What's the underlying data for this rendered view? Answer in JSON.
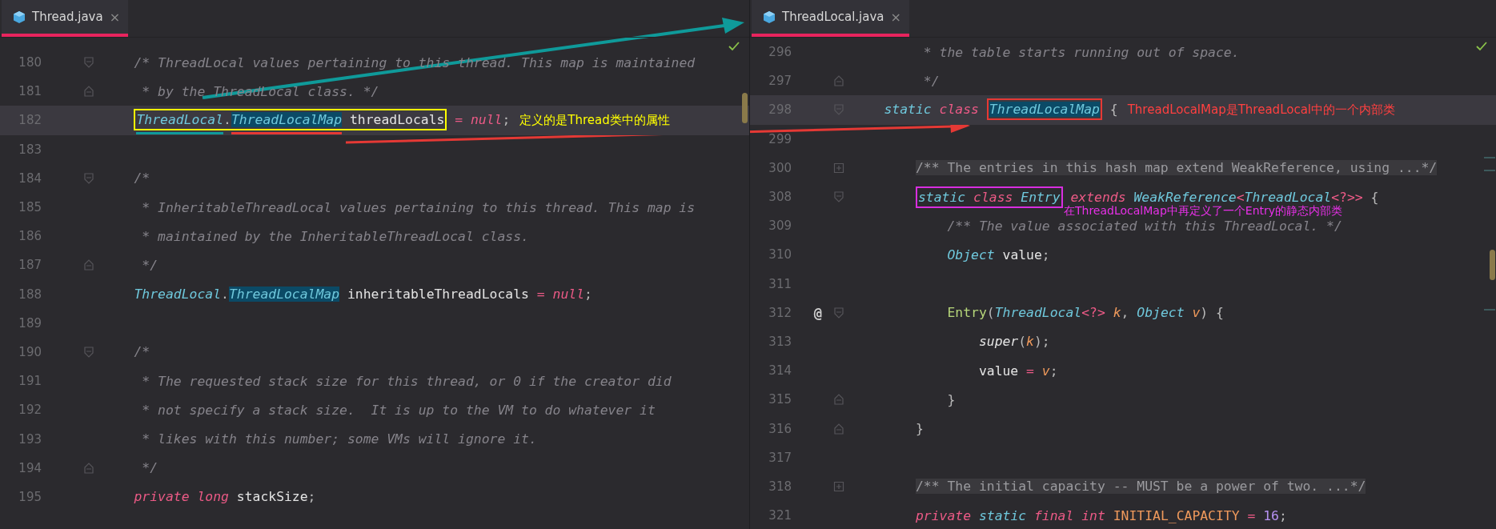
{
  "panes": [
    {
      "tab": {
        "label": "Thread.java",
        "close": "×",
        "selected": true
      },
      "lines": [
        {
          "number": "180",
          "fold_start": true,
          "tokens": [
            {
              "kind": "comment",
              "text": "    /* ThreadLocal values pertaining to this thread. This map is maintained"
            }
          ]
        },
        {
          "number": "181",
          "fold_end": true,
          "tokens": [
            {
              "kind": "comment",
              "text": "     * by the ThreadLocal class. */"
            }
          ]
        },
        {
          "number": "182",
          "current": true,
          "tokens": [
            {
              "kind": "box",
              "color": "#ffff00",
              "tokens": [
                {
                  "kind": "type",
                  "text": "    ThreadLocal",
                  "underline": {
                    "color": "#0f9a9a"
                  }
                },
                {
                  "kind": "punct",
                  "text": "."
                },
                {
                  "kind": "type",
                  "text": "ThreadLocalMap",
                  "highlighted": true,
                  "underline": {
                    "color": "#e53935"
                  }
                },
                {
                  "kind": "plain",
                  "text": " threadLocals"
                }
              ]
            },
            {
              "kind": "op",
              "text": " = "
            },
            {
              "kind": "keyword",
              "text": "null"
            },
            {
              "kind": "punct",
              "text": ";"
            },
            {
              "kind": "note",
              "color": "#ffff00",
              "text": "定义的是Thread类中的属性"
            }
          ]
        },
        {
          "number": "183"
        },
        {
          "number": "184",
          "fold_start": true,
          "tokens": [
            {
              "kind": "comment",
              "text": "    /*"
            }
          ]
        },
        {
          "number": "185",
          "tokens": [
            {
              "kind": "comment",
              "text": "     * InheritableThreadLocal values pertaining to this thread. This map is"
            }
          ]
        },
        {
          "number": "186",
          "tokens": [
            {
              "kind": "comment",
              "text": "     * maintained by the InheritableThreadLocal class."
            }
          ]
        },
        {
          "number": "187",
          "fold_end": true,
          "tokens": [
            {
              "kind": "comment",
              "text": "     */"
            }
          ]
        },
        {
          "number": "188",
          "tokens": [
            {
              "kind": "type",
              "text": "    ThreadLocal"
            },
            {
              "kind": "punct",
              "text": "."
            },
            {
              "kind": "type",
              "text": "ThreadLocalMap",
              "highlighted": true
            },
            {
              "kind": "plain",
              "text": " inheritableThreadLocals"
            },
            {
              "kind": "op",
              "text": " = "
            },
            {
              "kind": "keyword",
              "text": "null"
            },
            {
              "kind": "punct",
              "text": ";"
            }
          ]
        },
        {
          "number": "189"
        },
        {
          "number": "190",
          "fold_start": true,
          "tokens": [
            {
              "kind": "comment",
              "text": "    /*"
            }
          ]
        },
        {
          "number": "191",
          "tokens": [
            {
              "kind": "comment",
              "text": "     * The requested stack size for this thread, or 0 if the creator did"
            }
          ]
        },
        {
          "number": "192",
          "tokens": [
            {
              "kind": "comment",
              "text": "     * not specify a stack size.  It is up to the VM to do whatever it"
            }
          ]
        },
        {
          "number": "193",
          "tokens": [
            {
              "kind": "comment",
              "text": "     * likes with this number; some VMs will ignore it."
            }
          ]
        },
        {
          "number": "194",
          "fold_end": true,
          "tokens": [
            {
              "kind": "comment",
              "text": "     */"
            }
          ]
        },
        {
          "number": "195",
          "tokens": [
            {
              "kind": "keyword",
              "text": "    private"
            },
            {
              "kind": "keyword",
              "text": " long"
            },
            {
              "kind": "plain",
              "text": " stackSize"
            },
            {
              "kind": "punct",
              "text": ";"
            }
          ]
        }
      ]
    },
    {
      "tab": {
        "label": "ThreadLocal.java",
        "close": "×",
        "selected": true
      },
      "lines": [
        {
          "number": "296",
          "tokens": [
            {
              "kind": "comment",
              "text": "         * the table starts running out of space."
            }
          ]
        },
        {
          "number": "297",
          "fold_end": true,
          "tokens": [
            {
              "kind": "comment",
              "text": "         */"
            }
          ]
        },
        {
          "number": "298",
          "current": true,
          "fold_start": true,
          "tokens": [
            {
              "kind": "modifier",
              "text": "    static"
            },
            {
              "kind": "keyword",
              "text": " class"
            },
            {
              "kind": "box",
              "color": "#e53935",
              "tokens": [
                {
                  "kind": "type",
                  "text": " ThreadLocalMap",
                  "highlighted": true
                }
              ]
            },
            {
              "kind": "punct",
              "text": " {"
            },
            {
              "kind": "note",
              "color": "#ff4040",
              "text": "ThreadLocalMap是ThreadLocal中的一个内部类"
            }
          ]
        },
        {
          "number": "299"
        },
        {
          "number": "300",
          "collapsed": true,
          "tokens": [
            {
              "kind": "folded",
              "text": "        /** The entries in this hash map extend WeakReference, using ...*/"
            }
          ]
        },
        {
          "number": "308",
          "fold_start": true,
          "tokens": [
            {
              "kind": "box",
              "color": "#d82ee0",
              "tokens": [
                {
                  "kind": "modifier",
                  "text": "        static"
                },
                {
                  "kind": "keyword",
                  "text": " class"
                },
                {
                  "kind": "type",
                  "text": " Entry"
                }
              ]
            },
            {
              "kind": "keyword",
              "text": " extends"
            },
            {
              "kind": "type",
              "text": " WeakReference"
            },
            {
              "kind": "op",
              "text": "<"
            },
            {
              "kind": "type",
              "text": "ThreadLocal"
            },
            {
              "kind": "op",
              "text": "<?>>"
            },
            {
              "kind": "punct",
              "text": " {"
            },
            {
              "kind": "note",
              "below": true,
              "color": "#e830e8",
              "text": "在ThreadLocalMap中再定义了一个Entry的静态内部类"
            }
          ]
        },
        {
          "number": "309",
          "tokens": [
            {
              "kind": "comment",
              "text": "            /** The value associated with this ThreadLocal. */"
            }
          ]
        },
        {
          "number": "310",
          "tokens": [
            {
              "kind": "type",
              "text": "            Object"
            },
            {
              "kind": "plain",
              "text": " value"
            },
            {
              "kind": "punct",
              "text": ";"
            }
          ]
        },
        {
          "number": "311"
        },
        {
          "number": "312",
          "mark": "@",
          "fold_start": true,
          "tokens": [
            {
              "kind": "method",
              "text": "            Entry"
            },
            {
              "kind": "punct",
              "text": "("
            },
            {
              "kind": "type",
              "text": "ThreadLocal"
            },
            {
              "kind": "op",
              "text": "<?>"
            },
            {
              "kind": "param",
              "text": " k"
            },
            {
              "kind": "punct",
              "text": ", "
            },
            {
              "kind": "type",
              "text": "Object"
            },
            {
              "kind": "param",
              "text": " v"
            },
            {
              "kind": "punct",
              "text": ") {"
            }
          ]
        },
        {
          "number": "313",
          "tokens": [
            {
              "kind": "call",
              "text": "                super"
            },
            {
              "kind": "punct",
              "text": "("
            },
            {
              "kind": "param",
              "text": "k"
            },
            {
              "kind": "punct",
              "text": ");"
            }
          ]
        },
        {
          "number": "314",
          "tokens": [
            {
              "kind": "plain",
              "text": "                value"
            },
            {
              "kind": "op",
              "text": " = "
            },
            {
              "kind": "param",
              "text": "v"
            },
            {
              "kind": "punct",
              "text": ";"
            }
          ]
        },
        {
          "number": "315",
          "fold_end": true,
          "tokens": [
            {
              "kind": "punct",
              "text": "            }"
            }
          ]
        },
        {
          "number": "316",
          "fold_end": true,
          "tokens": [
            {
              "kind": "punct",
              "text": "        }"
            }
          ]
        },
        {
          "number": "317"
        },
        {
          "number": "318",
          "collapsed": true,
          "tokens": [
            {
              "kind": "folded",
              "text": "        /** The initial capacity -- MUST be a power of two. ...*/"
            }
          ]
        },
        {
          "number": "321",
          "tokens": [
            {
              "kind": "keyword",
              "text": "        private"
            },
            {
              "kind": "modifier",
              "text": " static"
            },
            {
              "kind": "keyword",
              "text": " final"
            },
            {
              "kind": "keyword",
              "text": " int"
            },
            {
              "kind": "constant",
              "text": " INITIAL_CAPACITY"
            },
            {
              "kind": "op",
              "text": " = "
            },
            {
              "kind": "number",
              "text": "16"
            },
            {
              "kind": "punct",
              "text": ";"
            }
          ]
        }
      ]
    }
  ]
}
